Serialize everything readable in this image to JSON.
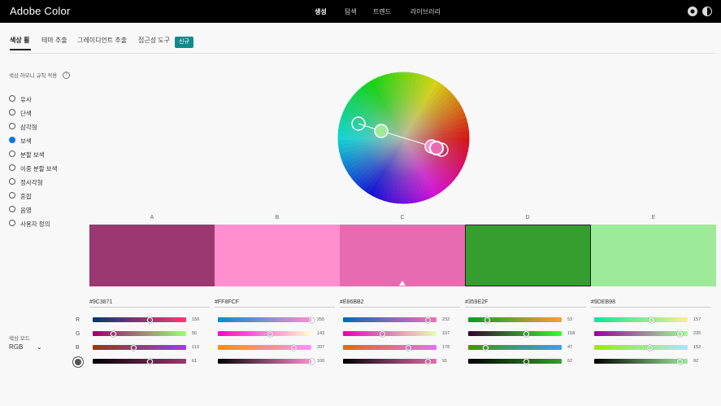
{
  "app": {
    "title": "Adobe Color"
  },
  "nav": {
    "items": [
      "생성",
      "탐색",
      "트렌드",
      "라이브러리"
    ],
    "active": 0
  },
  "subtabs": {
    "items": [
      "색상 휠",
      "테마 추출",
      "그레이디언트 추출",
      "접근성 도구"
    ],
    "badge": "신규"
  },
  "harmony": {
    "heading": "색상 하모니 규칙 적용",
    "help_icon": "help-icon",
    "rules": [
      "유사",
      "단색",
      "삼각형",
      "보색",
      "분할 보색",
      "이중 분할 보색",
      "정사각형",
      "혼합",
      "음영",
      "사용자 정의"
    ],
    "selected": 3
  },
  "color_mode": {
    "label": "색상 모드",
    "value": "RGB"
  },
  "channels": [
    "R",
    "G",
    "B"
  ],
  "swatches": [
    {
      "letter": "A",
      "hex": "#9C3871",
      "color": "#9C3871",
      "rgb": [
        156,
        56,
        113
      ],
      "brightness": 61
    },
    {
      "letter": "B",
      "hex": "#FF8FCF",
      "color": "#FF8FCF",
      "rgb": [
        255,
        143,
        207
      ],
      "brightness": 100
    },
    {
      "letter": "C",
      "hex": "#E86BB2",
      "color": "#E86BB2",
      "rgb": [
        232,
        107,
        178
      ],
      "brightness": 91
    },
    {
      "letter": "D",
      "hex": "#359E2F",
      "color": "#359E2F",
      "rgb": [
        53,
        158,
        47
      ],
      "brightness": 62
    },
    {
      "letter": "E",
      "hex": "#9DEB98",
      "color": "#9DEB98",
      "rgb": [
        157,
        235,
        152
      ],
      "brightness": 92
    }
  ],
  "selected_swatch": 3,
  "base_swatch": 2
}
